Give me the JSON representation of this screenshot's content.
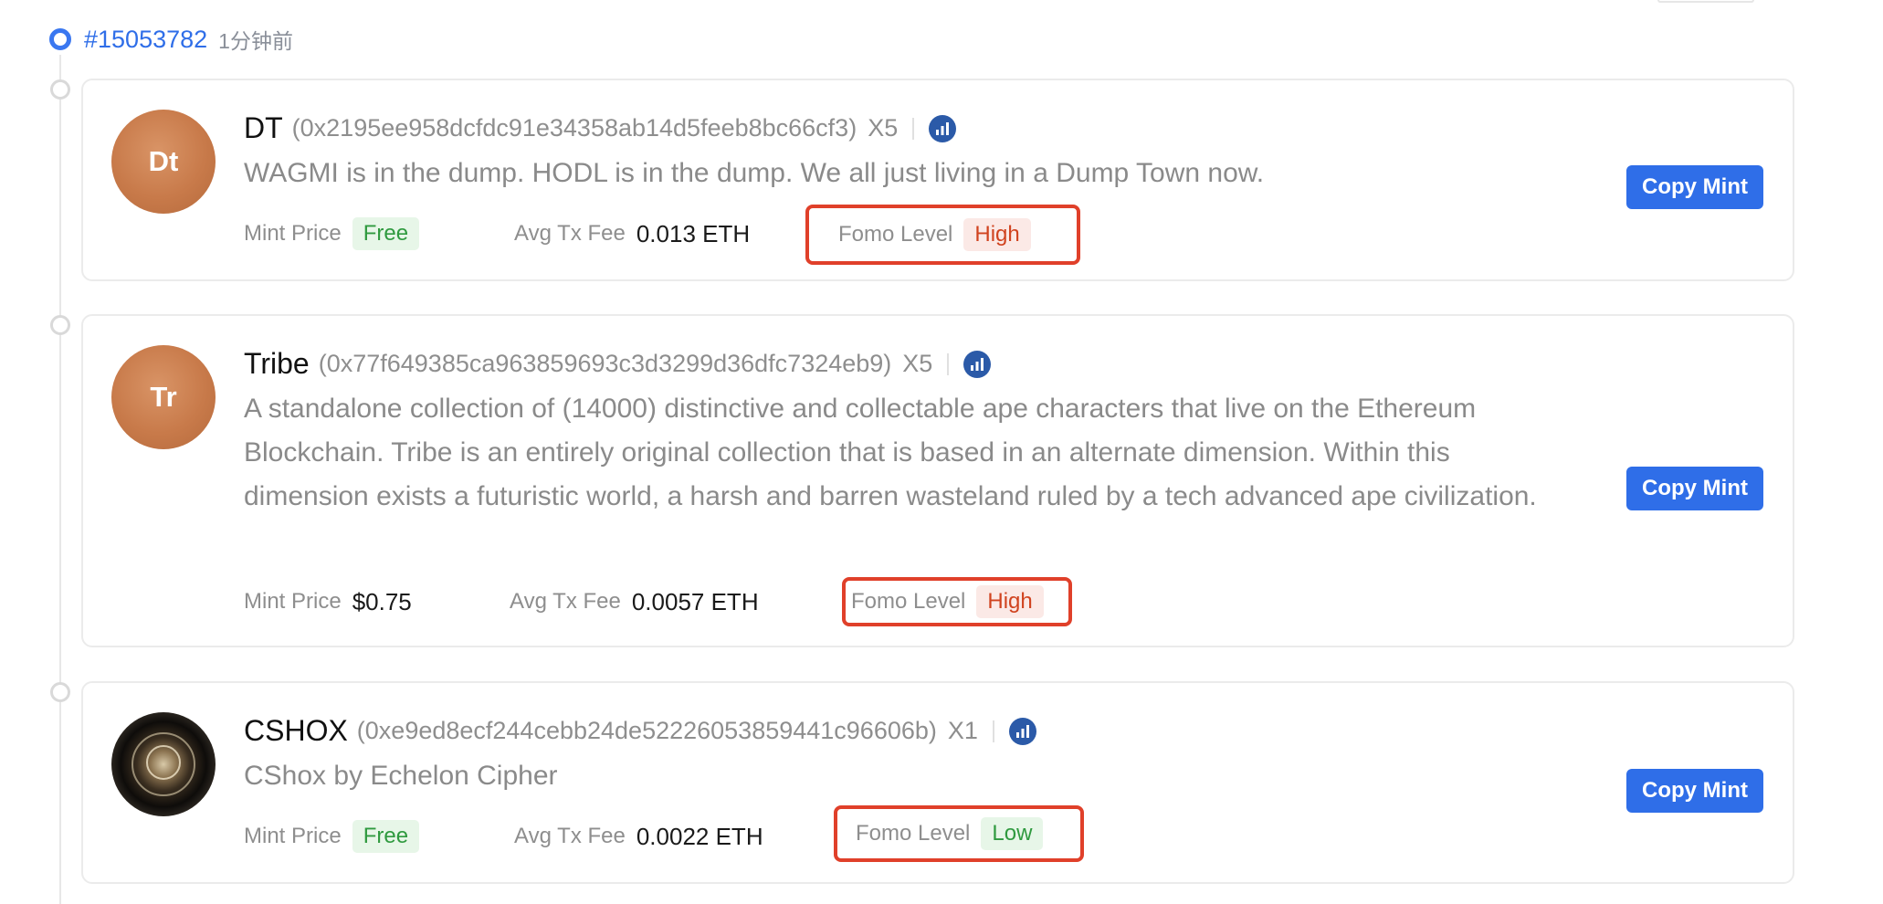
{
  "block": {
    "number": "#15053782",
    "time": "1分钟前"
  },
  "mints": [
    {
      "avatar_text": "Dt",
      "name": "DT",
      "address": "(0x2195ee958dcfdc91e34358ab14d5feeb8bc66cf3)",
      "multiplier": "X5",
      "description": "WAGMI is in the dump. HODL is in the dump. We all just living in a Dump Town now.",
      "mint_price_label": "Mint Price",
      "mint_price": "Free",
      "avg_fee_label": "Avg Tx Fee",
      "avg_fee": "0.013 ETH",
      "fomo_label": "Fomo Level",
      "fomo": "High",
      "button": "Copy Mint"
    },
    {
      "avatar_text": "Tr",
      "name": "Tribe",
      "address": "(0x77f649385ca963859693c3d3299d36dfc7324eb9)",
      "multiplier": "X5",
      "description": "A standalone collection of (14000) distinctive and collectable ape characters that live on the Ethereum Blockchain. Tribe is an entirely original collection that is based in an alternate dimension. Within this dimension exists a futuristic world, a harsh and barren wasteland ruled by a tech advanced ape civilization.",
      "mint_price_label": "Mint Price",
      "mint_price": "$0.75",
      "avg_fee_label": "Avg Tx Fee",
      "avg_fee": "0.0057 ETH",
      "fomo_label": "Fomo Level",
      "fomo": "High",
      "button": "Copy Mint"
    },
    {
      "avatar_text": "",
      "name": "CSHOX",
      "address": "(0xe9ed8ecf244cebb24de52226053859441c96606b)",
      "multiplier": "X1",
      "description": "CShox by Echelon Cipher",
      "mint_price_label": "Mint Price",
      "mint_price": "Free",
      "avg_fee_label": "Avg Tx Fee",
      "avg_fee": "0.0022 ETH",
      "fomo_label": "Fomo Level",
      "fomo": "Low",
      "button": "Copy Mint"
    }
  ],
  "colors": {
    "accent": "#2f6ee8",
    "highlight_box": "#e0402a",
    "free_tag": "#2f9a3f",
    "high_tag": "#d0431f"
  },
  "icons": {
    "block_marker": "circle-icon",
    "chart": "chart-icon"
  }
}
